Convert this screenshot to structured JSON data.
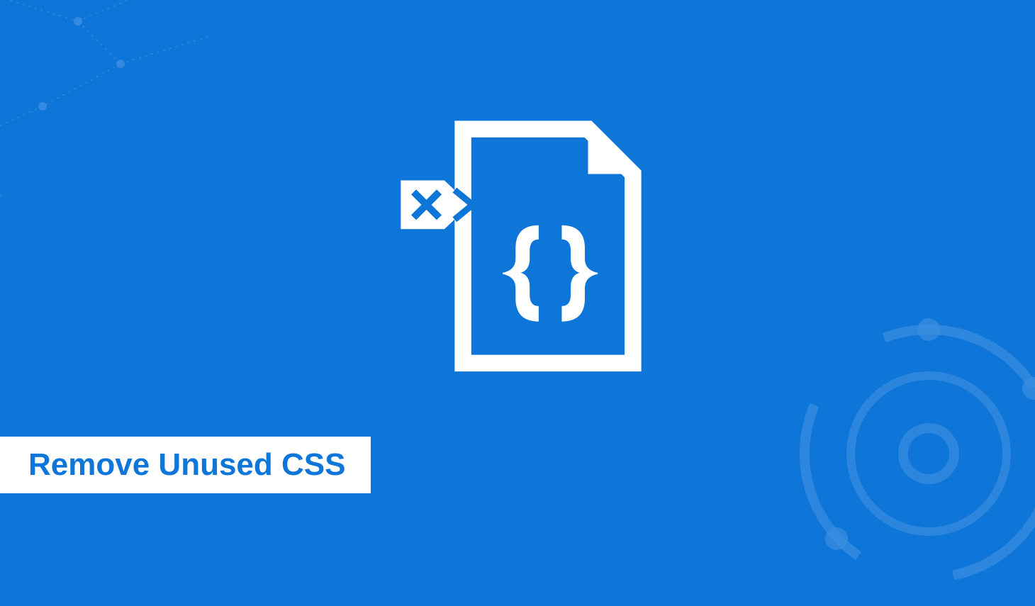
{
  "title": "Remove Unused CSS",
  "colors": {
    "background": "#0e75d9",
    "foreground": "#ffffff",
    "title_text": "#0e75d9",
    "deco_line": "#3a8ee0"
  },
  "icons": {
    "hero": "css-file-remove-icon",
    "deco_corner": "network-decor-icon",
    "deco_logo": "logo-decor-icon",
    "tag_glyph": "x-icon",
    "file_glyph": "braces-icon"
  }
}
